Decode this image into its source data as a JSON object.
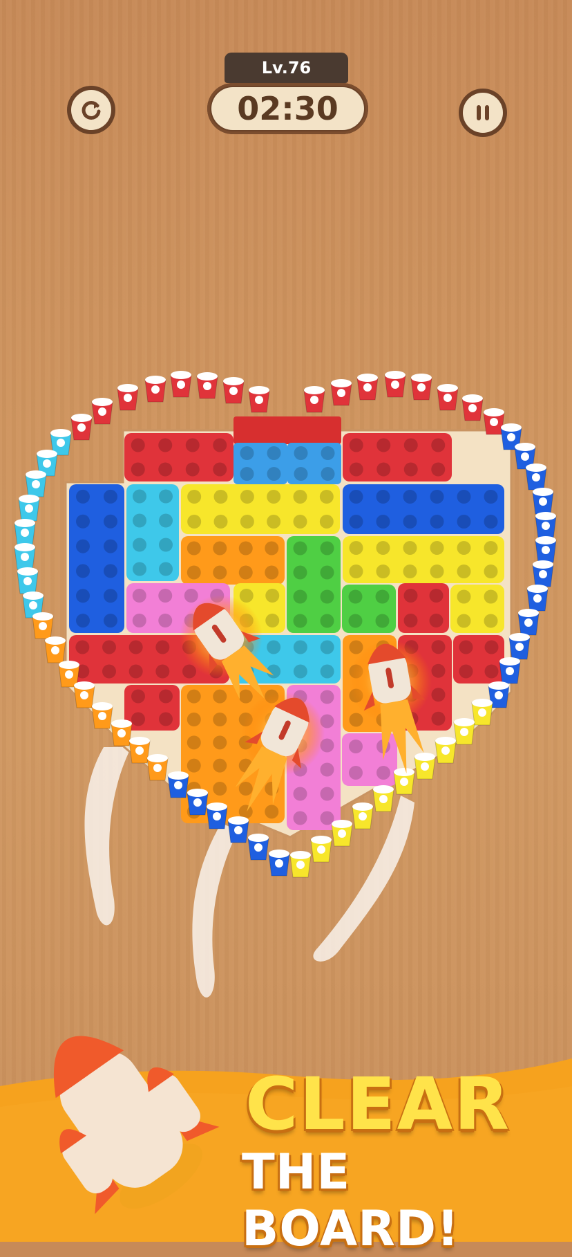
{
  "hud": {
    "level": "Lv.76",
    "timer": "02:30"
  },
  "banner": {
    "line1": "CLEAR",
    "line2": "THE BOARD!"
  },
  "colors": {
    "red": "#e0333a",
    "blue": "#1f5fe0",
    "cyan": "#3ec8ea",
    "yellow": "#f7e62b",
    "orange": "#ff9a1a",
    "green": "#4fcf44",
    "pink": "#f27fd6",
    "light_blue": "#3c9ee8"
  },
  "icons": {
    "restart": "restart-icon",
    "pause": "pause-icon",
    "rocket": "rocket-icon"
  }
}
